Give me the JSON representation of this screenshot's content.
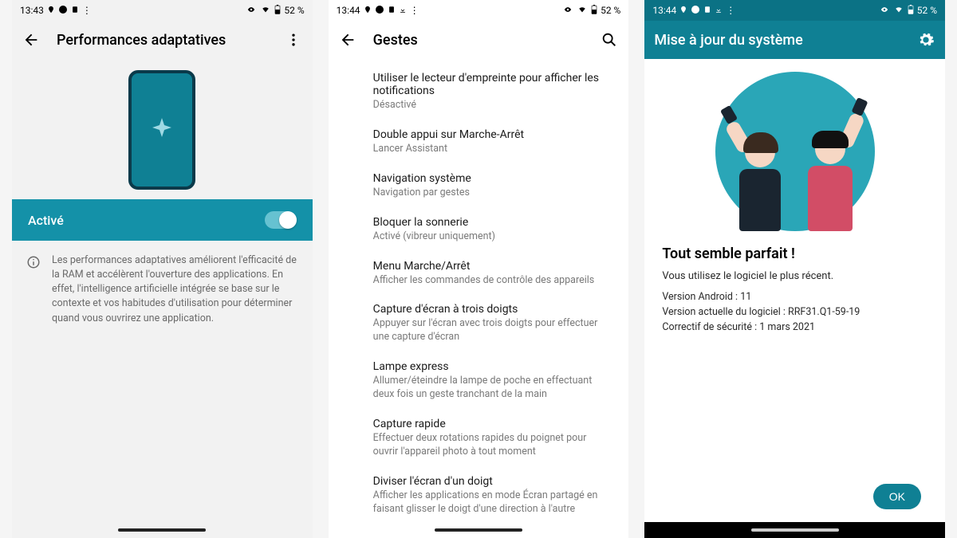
{
  "statusbar": {
    "time1": "13:43",
    "time2": "13:44",
    "time3": "13:44",
    "battery": "52 %"
  },
  "screen1": {
    "title": "Performances adaptatives",
    "toggle_label": "Activé",
    "description": "Les performances adaptatives améliorent l'efficacité de la RAM et accélèrent l'ouverture des applications. En effet, l'intelligence artificielle intégrée se base sur le contexte et vos habitudes d'utilisation pour déterminer quand vous ouvrirez une application."
  },
  "screen2": {
    "title": "Gestes",
    "items": [
      {
        "title": "Utiliser le lecteur d'empreinte pour afficher les notifications",
        "subtitle": "Désactivé"
      },
      {
        "title": "Double appui sur Marche-Arrêt",
        "subtitle": "Lancer Assistant"
      },
      {
        "title": "Navigation système",
        "subtitle": "Navigation par gestes"
      },
      {
        "title": "Bloquer la sonnerie",
        "subtitle": "Activé (vibreur uniquement)"
      },
      {
        "title": "Menu Marche/Arrêt",
        "subtitle": "Afficher les commandes de contrôle des appareils"
      },
      {
        "title": "Capture d'écran à trois doigts",
        "subtitle": "Appuyer sur l'écran avec trois doigts pour effectuer une capture d'écran"
      },
      {
        "title": "Lampe express",
        "subtitle": "Allumer/éteindre la lampe de poche en effectuant deux fois un geste tranchant de la main"
      },
      {
        "title": "Capture rapide",
        "subtitle": "Effectuer deux rotations rapides du poignet pour ouvrir l'appareil photo à tout moment"
      },
      {
        "title": "Diviser l'écran d'un doigt",
        "subtitle": "Afficher les applications en mode Écran partagé en faisant glisser le doigt d'une direction à l'autre"
      }
    ]
  },
  "screen3": {
    "title": "Mise à jour du système",
    "headline": "Tout semble parfait !",
    "line1": "Vous utilisez le logiciel le plus récent.",
    "meta_android_label": "Version Android : ",
    "meta_android_value": "11",
    "meta_sw_label": "Version actuelle du logiciel : ",
    "meta_sw_value": "RRF31.Q1-59-19",
    "meta_patch_label": "Correctif de sécurité : ",
    "meta_patch_value": "1 mars 2021",
    "ok": "OK"
  }
}
